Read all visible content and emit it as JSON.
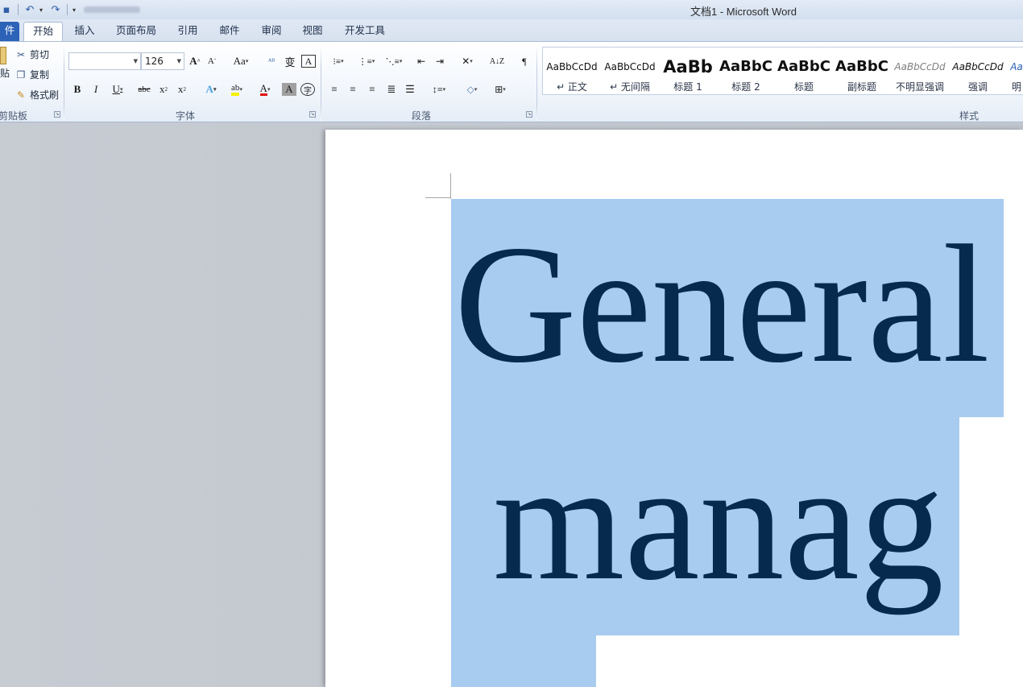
{
  "window": {
    "title": "文档1  -  Microsoft Word"
  },
  "quick_access": {
    "save_icon": "save-icon",
    "undo_icon": "undo-icon",
    "redo_icon": "redo-icon"
  },
  "tabs": [
    {
      "label": "件"
    },
    {
      "label": "开始"
    },
    {
      "label": "插入"
    },
    {
      "label": "页面布局"
    },
    {
      "label": "引用"
    },
    {
      "label": "邮件"
    },
    {
      "label": "审阅"
    },
    {
      "label": "视图"
    },
    {
      "label": "开发工具"
    }
  ],
  "clipboard": {
    "paste_label": "贴",
    "cut_label": "剪切",
    "copy_label": "复制",
    "format_painter_label": "格式刷",
    "group_label": "剪贴板"
  },
  "font": {
    "font_name": "",
    "font_size": "126",
    "group_label": "字体"
  },
  "paragraph": {
    "group_label": "段落"
  },
  "styles": {
    "group_label": "样式",
    "items": [
      {
        "sample": "AaBbCcDd",
        "name": "↵ 正文"
      },
      {
        "sample": "AaBbCcDd",
        "name": "↵ 无间隔"
      },
      {
        "sample": "AaBb",
        "name": "标题 1"
      },
      {
        "sample": "AaBbC",
        "name": "标题 2"
      },
      {
        "sample": "AaBbC",
        "name": "标题"
      },
      {
        "sample": "AaBbC",
        "name": "副标题"
      },
      {
        "sample": "AaBbCcDd",
        "name": "不明显强调"
      },
      {
        "sample": "AaBbCcDd",
        "name": "强调"
      },
      {
        "sample": "Aa",
        "name": "明"
      }
    ]
  },
  "document": {
    "line1": "General",
    "line2": "manag"
  }
}
